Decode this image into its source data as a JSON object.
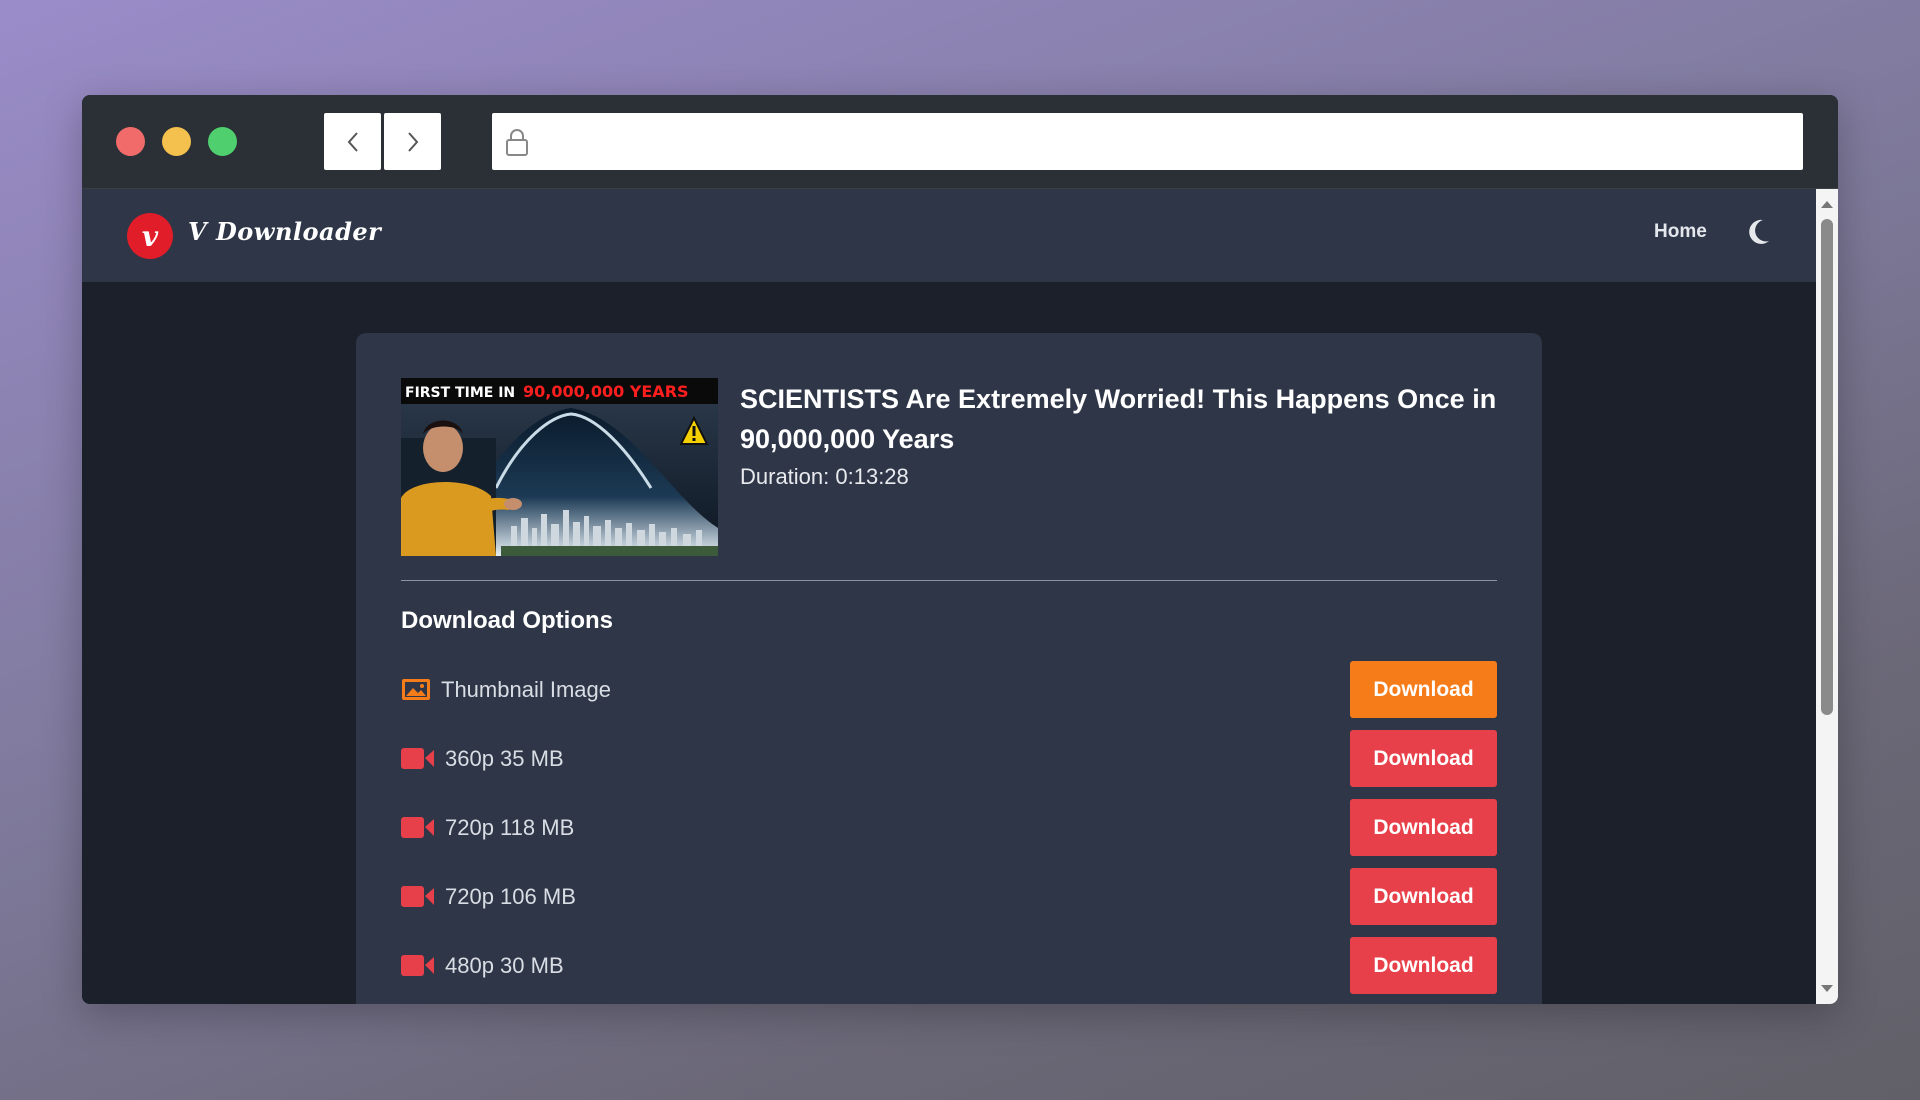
{
  "browser": {
    "url": ""
  },
  "site": {
    "brand_letter": "v",
    "brand_name": "V Downloader",
    "nav_home": "Home"
  },
  "video": {
    "title": "SCIENTISTS Are Extremely Worried! This Happens Once in 90,000,000 Years",
    "duration": "Duration: 0:13:28",
    "thumbnail_text_white": "FIRST TIME IN ",
    "thumbnail_text_red": "90,000,000 YEARS"
  },
  "download": {
    "heading": "Download Options",
    "options": [
      {
        "label": "Thumbnail Image",
        "button": "Download",
        "icon": "image-icon"
      },
      {
        "label": "360p 35 MB",
        "button": "Download",
        "icon": "video-camera-icon"
      },
      {
        "label": "720p 118 MB",
        "button": "Download",
        "icon": "video-camera-icon"
      },
      {
        "label": "720p 106 MB",
        "button": "Download",
        "icon": "video-camera-icon"
      },
      {
        "label": "480p 30 MB",
        "button": "Download",
        "icon": "video-camera-icon"
      }
    ]
  },
  "colors": {
    "accent_orange": "#f67b19",
    "accent_red": "#e8404a",
    "header_bg": "#2e3647",
    "page_bg": "#1b202a",
    "brand_red": "#e11d2a"
  }
}
